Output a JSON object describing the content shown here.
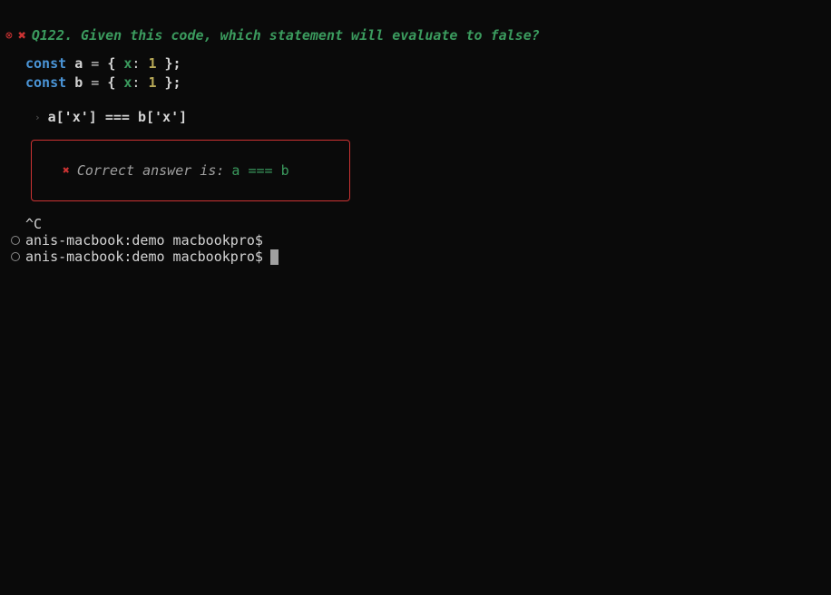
{
  "question": {
    "id": "Q122",
    "text": "Q122. Given this code, which statement will evaluate to false?"
  },
  "code": {
    "line1": {
      "keyword": "const",
      "var": "a",
      "eq": "=",
      "open": "{",
      "key": "x",
      "colon": ":",
      "val": "1",
      "close": "};"
    },
    "line2": {
      "keyword": "const",
      "var": "b",
      "eq": "=",
      "open": "{",
      "key": "x",
      "colon": ":",
      "val": "1",
      "close": "};"
    }
  },
  "user_answer": "a['x'] === b['x']",
  "feedback": {
    "label": "Correct answer is:",
    "answer": "a === b"
  },
  "interrupt": "^C",
  "prompts": {
    "p1": "anis-macbook:demo macbookpro$",
    "p2": "anis-macbook:demo macbookpro$"
  }
}
